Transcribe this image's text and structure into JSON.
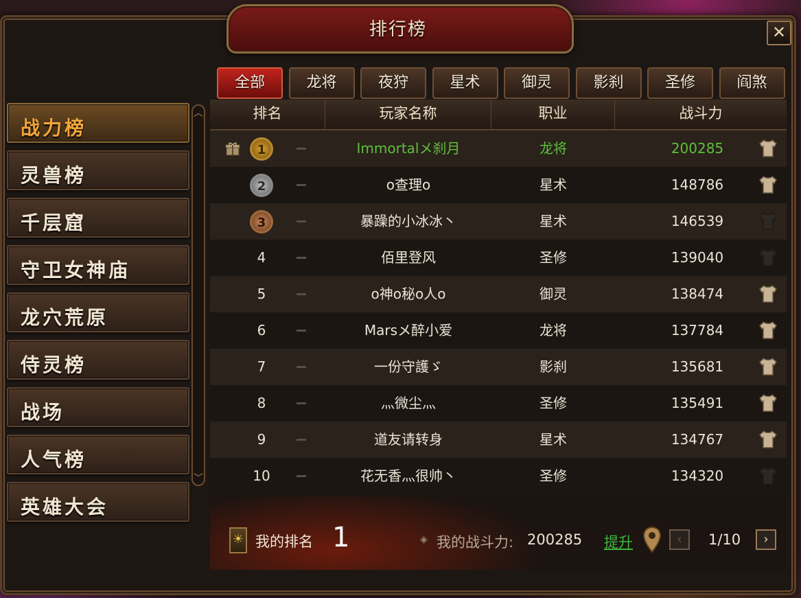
{
  "window": {
    "title": "排行榜",
    "close_label": "✕"
  },
  "sidebar": {
    "items": [
      {
        "label": "战力榜",
        "active": true
      },
      {
        "label": "灵兽榜"
      },
      {
        "label": "千层窟"
      },
      {
        "label": "守卫女神庙"
      },
      {
        "label": "龙穴荒原"
      },
      {
        "label": "侍灵榜"
      },
      {
        "label": "战场"
      },
      {
        "label": "人气榜"
      },
      {
        "label": "英雄大会"
      }
    ]
  },
  "tabs": [
    "全部",
    "龙将",
    "夜狩",
    "星术",
    "御灵",
    "影刹",
    "圣修",
    "阎煞"
  ],
  "active_tab": "全部",
  "table": {
    "headers": [
      "排名",
      "玩家名称",
      "职业",
      "战斗力"
    ],
    "rows": [
      {
        "rank": "1",
        "name": "Immortalメ刹月",
        "class": "龙将",
        "power": "200285",
        "medal": "gold",
        "gift": true,
        "highlight": true,
        "equip_lit": true
      },
      {
        "rank": "2",
        "name": "o查理o",
        "class": "星术",
        "power": "148786",
        "medal": "silver",
        "equip_lit": true
      },
      {
        "rank": "3",
        "name": "暴躁的小冰冰丶",
        "class": "星术",
        "power": "146539",
        "medal": "bronze",
        "equip_lit": false
      },
      {
        "rank": "4",
        "name": "佰里登风",
        "class": "圣修",
        "power": "139040",
        "equip_lit": false
      },
      {
        "rank": "5",
        "name": "o神o秘o人o",
        "class": "御灵",
        "power": "138474",
        "equip_lit": true
      },
      {
        "rank": "6",
        "name": "Marsメ醉小爱",
        "class": "龙将",
        "power": "137784",
        "equip_lit": true
      },
      {
        "rank": "7",
        "name": "一份守護ゞ",
        "class": "影刹",
        "power": "135681",
        "equip_lit": true
      },
      {
        "rank": "8",
        "name": "灬微尘灬",
        "class": "圣修",
        "power": "135491",
        "equip_lit": true
      },
      {
        "rank": "9",
        "name": "道友请转身",
        "class": "星术",
        "power": "134767",
        "equip_lit": true
      },
      {
        "rank": "10",
        "name": "花无香灬很帅丶",
        "class": "圣修",
        "power": "134320",
        "equip_lit": false
      }
    ]
  },
  "footer": {
    "my_rank_label": "我的排名",
    "my_rank_value": "1",
    "my_power_label": "我的战斗力:",
    "my_power_value": "200285",
    "improve_label": "提升",
    "prev_icon": "‹",
    "next_icon": "›",
    "page_text": "1/10",
    "my_rank_icon": "☀",
    "diamond_icon": "◈"
  },
  "colors": {
    "highlight_green": "#5ec03a",
    "active_orange": "#f3a63a",
    "tab_active_red": "#c0231c"
  }
}
